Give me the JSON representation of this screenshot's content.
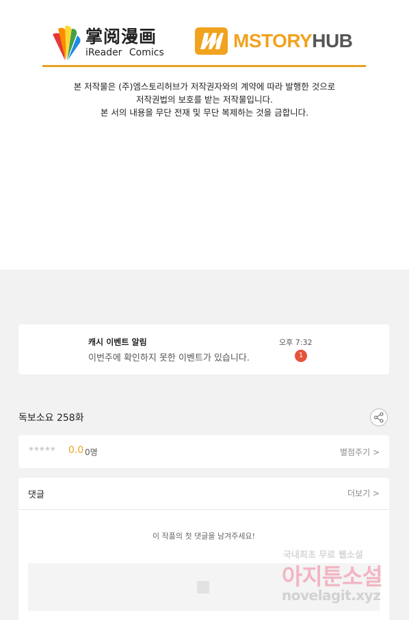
{
  "brands": {
    "ireader": {
      "name_zh": "掌阅漫画",
      "name_en": "iReader Comics"
    },
    "mstory": {
      "name_a": "MSTORY",
      "name_b": "HUB"
    }
  },
  "notice": {
    "line1": "본 저작물은 (주)엠스토리허브가 저작권자와의 계약에 따라 발행한 것으로",
    "line2": "저작권법의 보호를 받는 저작물입니다.",
    "line3": "본 서의 내용을 무단 전재 및 무단 복제하는 것을 금합니다."
  },
  "event": {
    "title": "캐시 이벤트 알림",
    "desc": "이번주에 확인하지 못한 이벤트가 있습니다.",
    "time": "오후 7:32",
    "badge": "1"
  },
  "episode": {
    "title": "독보소요 258화"
  },
  "rating": {
    "score": "0.0",
    "count": "0명",
    "action": "별점주기 >",
    "stars_filled": 0,
    "stars_total": 5
  },
  "comments": {
    "header": "댓글",
    "more": "더보기 >",
    "empty": "이 작품의 첫 댓글을 남겨주세요!"
  },
  "watermark": {
    "line1": "국내최초 무료 웹소설",
    "line2": "아지툰소설",
    "line3": "novelagit.xyz"
  },
  "colors": {
    "accent": "#e6a021",
    "badge": "#e5533b"
  }
}
